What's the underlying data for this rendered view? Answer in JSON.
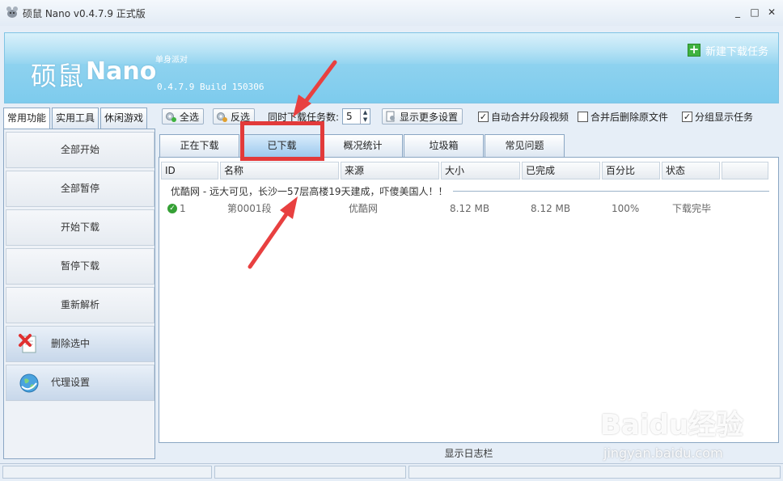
{
  "window": {
    "title": "硕鼠 Nano v0.4.7.9 正式版",
    "minimize_glyph": "_",
    "maximize_glyph": "□",
    "close_glyph": "✕"
  },
  "banner": {
    "logo_cn": "硕鼠",
    "logo_en": "Nano",
    "tag": "单身派对",
    "build": "0.4.7.9 Build 150306",
    "new_task": "新建下载任务"
  },
  "left_tabs": [
    "常用功能",
    "实用工具",
    "休闲游戏"
  ],
  "sidebar": {
    "items": [
      "全部开始",
      "全部暂停",
      "开始下载",
      "暂停下载",
      "重新解析",
      "删除选中",
      "代理设置"
    ]
  },
  "toolbar": {
    "select_all": "全选",
    "invert": "反选",
    "concurrent_label": "同时下载任务数:",
    "concurrent_value": "5",
    "more_settings": "显示更多设置",
    "auto_merge": "自动合并分段视频",
    "delete_after_merge": "合并后删除原文件",
    "group_display": "分组显示任务",
    "auto_merge_checked": "✓",
    "delete_after_merge_checked": "",
    "group_display_checked": "✓"
  },
  "main_tabs": [
    "正在下载",
    "已下载",
    "概况统计",
    "垃圾箱",
    "常见问题"
  ],
  "table": {
    "headers": [
      "ID",
      "名称",
      "来源",
      "大小",
      "已完成",
      "百分比",
      "状态"
    ],
    "group_title": "优酷网 - 远大可见，长沙一57层高楼19天建成，吓傻美国人！！",
    "rows": [
      {
        "id": "1",
        "name": "第0001段",
        "source": "优酷网",
        "size": "8.12 MB",
        "done": "8.12 MB",
        "percent": "100%",
        "status": "下载完毕"
      }
    ]
  },
  "log_bar": "显示日志栏",
  "watermark": {
    "brand": "Baidu经验",
    "url": "jingyan.baidu.com"
  },
  "colors": {
    "banner": "#8ed2ef",
    "highlight": "#e23a3a",
    "accent_green": "#3fb23f"
  }
}
